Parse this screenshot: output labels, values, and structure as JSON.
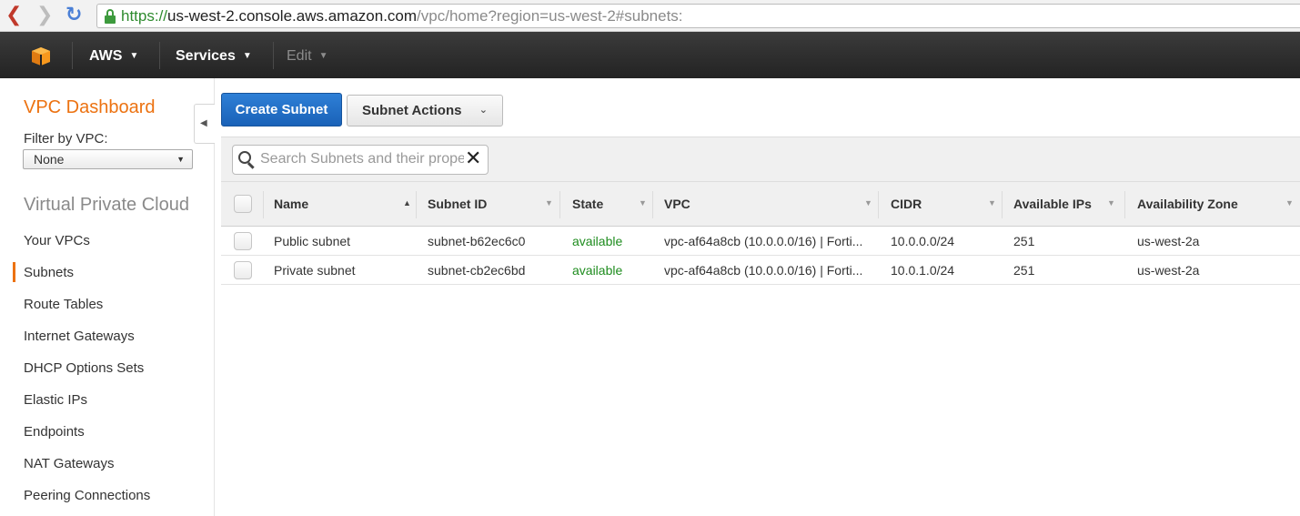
{
  "browser": {
    "url_secure": "https://",
    "url_host": "us-west-2.console.aws.amazon.com",
    "url_path": "/vpc/home?region=us-west-2#subnets:"
  },
  "topnav": {
    "aws_label": "AWS",
    "services_label": "Services",
    "edit_label": "Edit"
  },
  "sidebar": {
    "title": "VPC Dashboard",
    "filter_label": "Filter by VPC:",
    "filter_value": "None",
    "section": "Virtual Private Cloud",
    "items": [
      {
        "label": "Your VPCs"
      },
      {
        "label": "Subnets"
      },
      {
        "label": "Route Tables"
      },
      {
        "label": "Internet Gateways"
      },
      {
        "label": "DHCP Options Sets"
      },
      {
        "label": "Elastic IPs"
      },
      {
        "label": "Endpoints"
      },
      {
        "label": "NAT Gateways"
      },
      {
        "label": "Peering Connections"
      }
    ]
  },
  "toolbar": {
    "create_label": "Create Subnet",
    "actions_label": "Subnet Actions"
  },
  "search": {
    "placeholder": "Search Subnets and their properties"
  },
  "table": {
    "columns": [
      "Name",
      "Subnet ID",
      "State",
      "VPC",
      "CIDR",
      "Available IPs",
      "Availability Zone"
    ],
    "rows": [
      {
        "name": "Public subnet",
        "subnet_id": "subnet-b62ec6c0",
        "state": "available",
        "vpc": "vpc-af64a8cb (10.0.0.0/16) | Forti...",
        "cidr": "10.0.0.0/24",
        "available_ips": "251",
        "az": "us-west-2a"
      },
      {
        "name": "Private subnet",
        "subnet_id": "subnet-cb2ec6bd",
        "state": "available",
        "vpc": "vpc-af64a8cb (10.0.0.0/16) | Forti...",
        "cidr": "10.0.1.0/24",
        "available_ips": "251",
        "az": "us-west-2a"
      }
    ]
  },
  "colors": {
    "accent_orange": "#ec7211",
    "primary_blue": "#1a62b8",
    "state_green": "#1e8c1e"
  }
}
